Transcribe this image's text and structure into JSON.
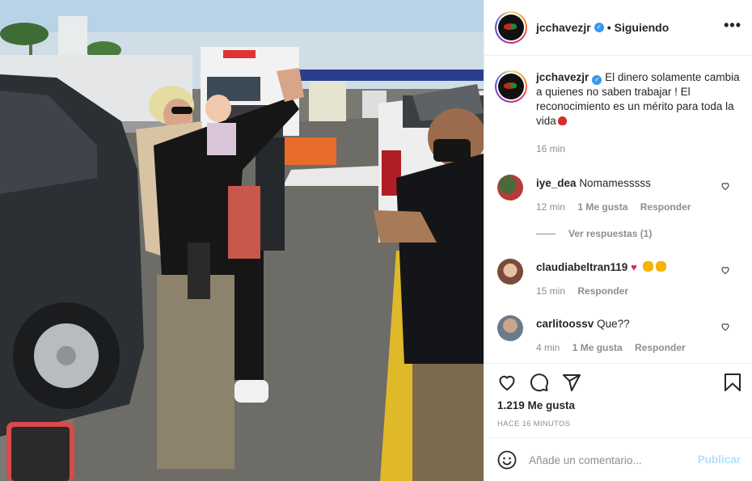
{
  "header": {
    "username": "jcchavezjr",
    "separator": "•",
    "follow_status": "Siguiendo",
    "more_label": "•••"
  },
  "caption": {
    "username": "jcchavezjr",
    "text": "El dinero solamente cambia a quienes no saben trabajar ! El reconocimiento es un mérito para toda la vida",
    "time": "16 min"
  },
  "comments": [
    {
      "username": "iye_dea",
      "text": "Nomamesssss",
      "time": "12 min",
      "likes": "1 Me gusta",
      "reply_label": "Responder",
      "view_replies": "Ver respuestas (1)",
      "avatar_color": "#b83a3a"
    },
    {
      "username": "claudiabeltran119",
      "text": "",
      "time": "15 min",
      "likes": "",
      "reply_label": "Responder",
      "avatar_color": "#7a4a3a"
    },
    {
      "username": "carlitoossv",
      "text": "Que??",
      "time": "4 min",
      "likes": "1 Me gusta",
      "reply_label": "Responder",
      "avatar_color": "#6b7a8a"
    }
  ],
  "actions": {
    "like_icon": "heart-icon",
    "comment_icon": "comment-icon",
    "share_icon": "share-icon",
    "save_icon": "bookmark-icon"
  },
  "likes_count": "1.219 Me gusta",
  "post_time": "HACE 16 MINUTOS",
  "add_comment": {
    "placeholder": "Añade un comentario...",
    "publish_label": "Publicar",
    "emoji_icon": "smiley-icon"
  },
  "colors": {
    "verified": "#3897f0",
    "link_disabled": "#b2dffc",
    "secondary_text": "#8e8e8e",
    "border": "#efefef"
  }
}
